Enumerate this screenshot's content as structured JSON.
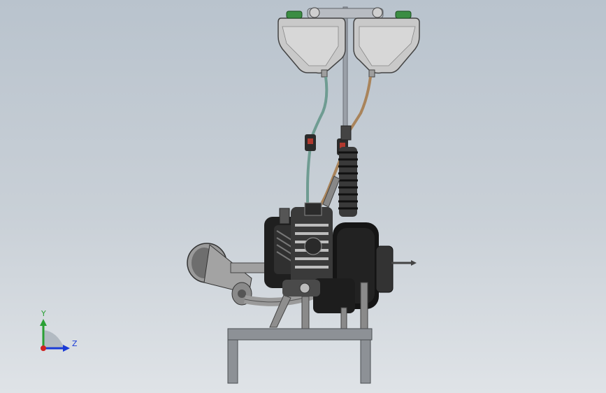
{
  "viewport": {
    "background_top": "#b9c3cd",
    "background_bottom": "#dfe3e7"
  },
  "model": {
    "description_icon": "engine-assembly-icon",
    "colors": {
      "steel_dark": "#2b2b2b",
      "steel_mid": "#6e6e6e",
      "steel_light": "#bdbdbd",
      "frame": "#8d9196",
      "tank": "#c8c8c8",
      "fuel_line_green": "#6f9c92",
      "fuel_line_brown": "#a9845b",
      "filter_red": "#b0392f",
      "cap_green": "#3b8d43"
    }
  },
  "triad": {
    "y_label": "Y",
    "z_label": "Z",
    "y_color": "#2aa035",
    "z_color": "#1a3bd6",
    "origin_color": "#d02020"
  }
}
